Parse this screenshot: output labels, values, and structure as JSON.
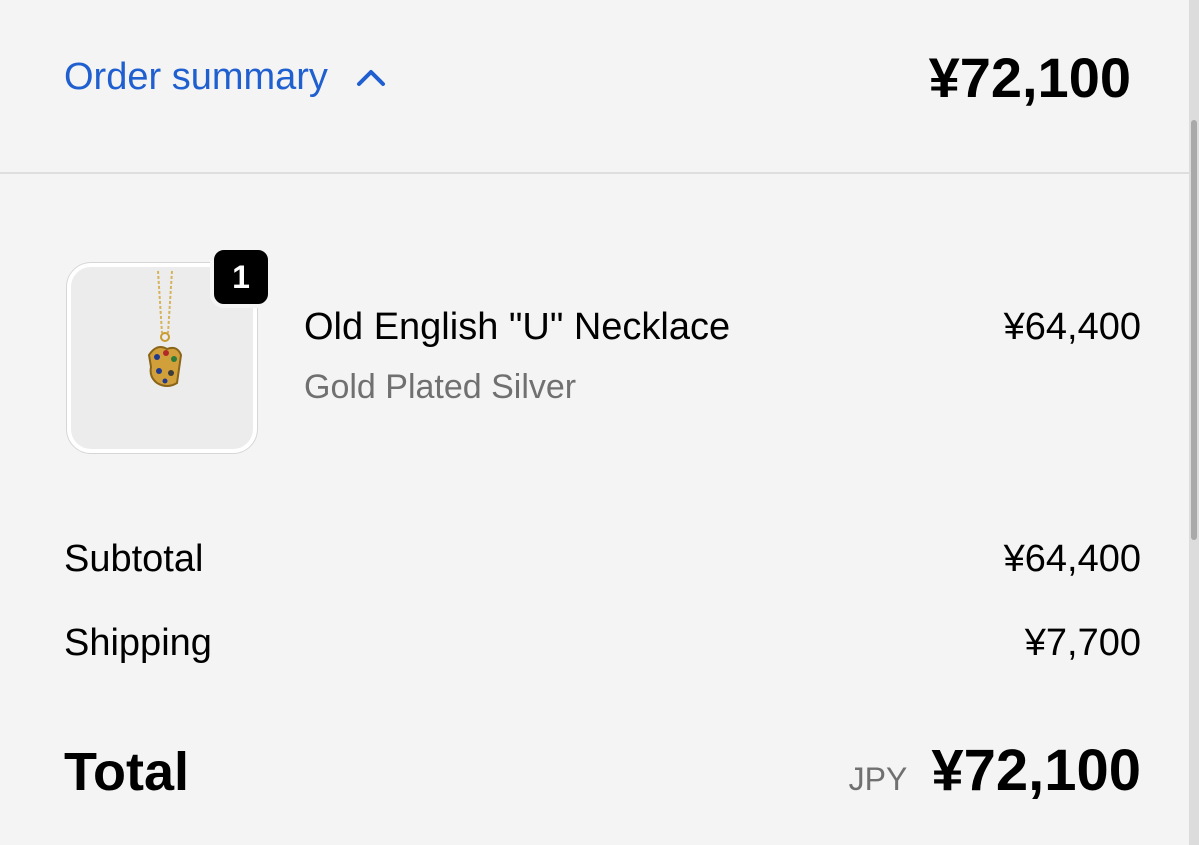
{
  "summary": {
    "toggle_label": "Order summary",
    "header_total": "¥72,100"
  },
  "item": {
    "quantity": "1",
    "name": "Old English \"U\" Necklace",
    "variant": "Gold Plated Silver",
    "price": "¥64,400"
  },
  "costs": {
    "subtotal_label": "Subtotal",
    "subtotal_value": "¥64,400",
    "shipping_label": "Shipping",
    "shipping_value": "¥7,700"
  },
  "total": {
    "label": "Total",
    "currency": "JPY",
    "value": "¥72,100"
  },
  "colors": {
    "accent": "#1f5fcf",
    "background": "#f4f4f4",
    "muted_text": "#707070"
  }
}
